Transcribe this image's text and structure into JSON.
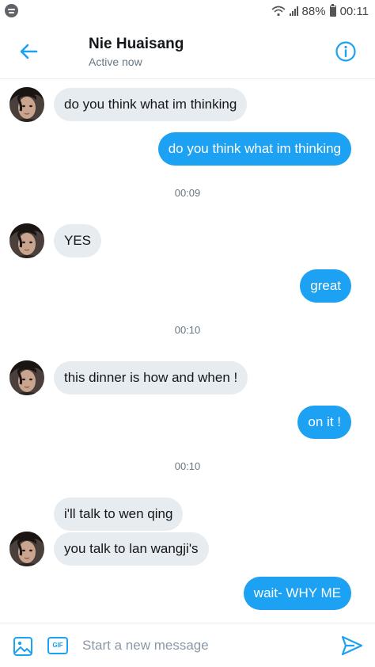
{
  "status_bar": {
    "battery": "88%",
    "time": "00:11"
  },
  "header": {
    "title": "Nie Huaisang",
    "subtitle": "Active now"
  },
  "messages": {
    "m1": "do you think what im thinking",
    "m2": "do you think what im thinking",
    "t1": "00:09",
    "m3": "YES",
    "m4": "great",
    "t2": "00:10",
    "m5": "this dinner is how and when !",
    "m6": "on it !",
    "t3": "00:10",
    "m7": "i'll talk to wen qing",
    "m8": "you talk to lan wangji's",
    "m9": "wait- WHY ME"
  },
  "composer": {
    "placeholder": "Start a new message",
    "gif_label": "GIF"
  },
  "colors": {
    "accent": "#1da1f2",
    "incoming_bubble": "#e6ecf0",
    "muted": "#657786"
  }
}
